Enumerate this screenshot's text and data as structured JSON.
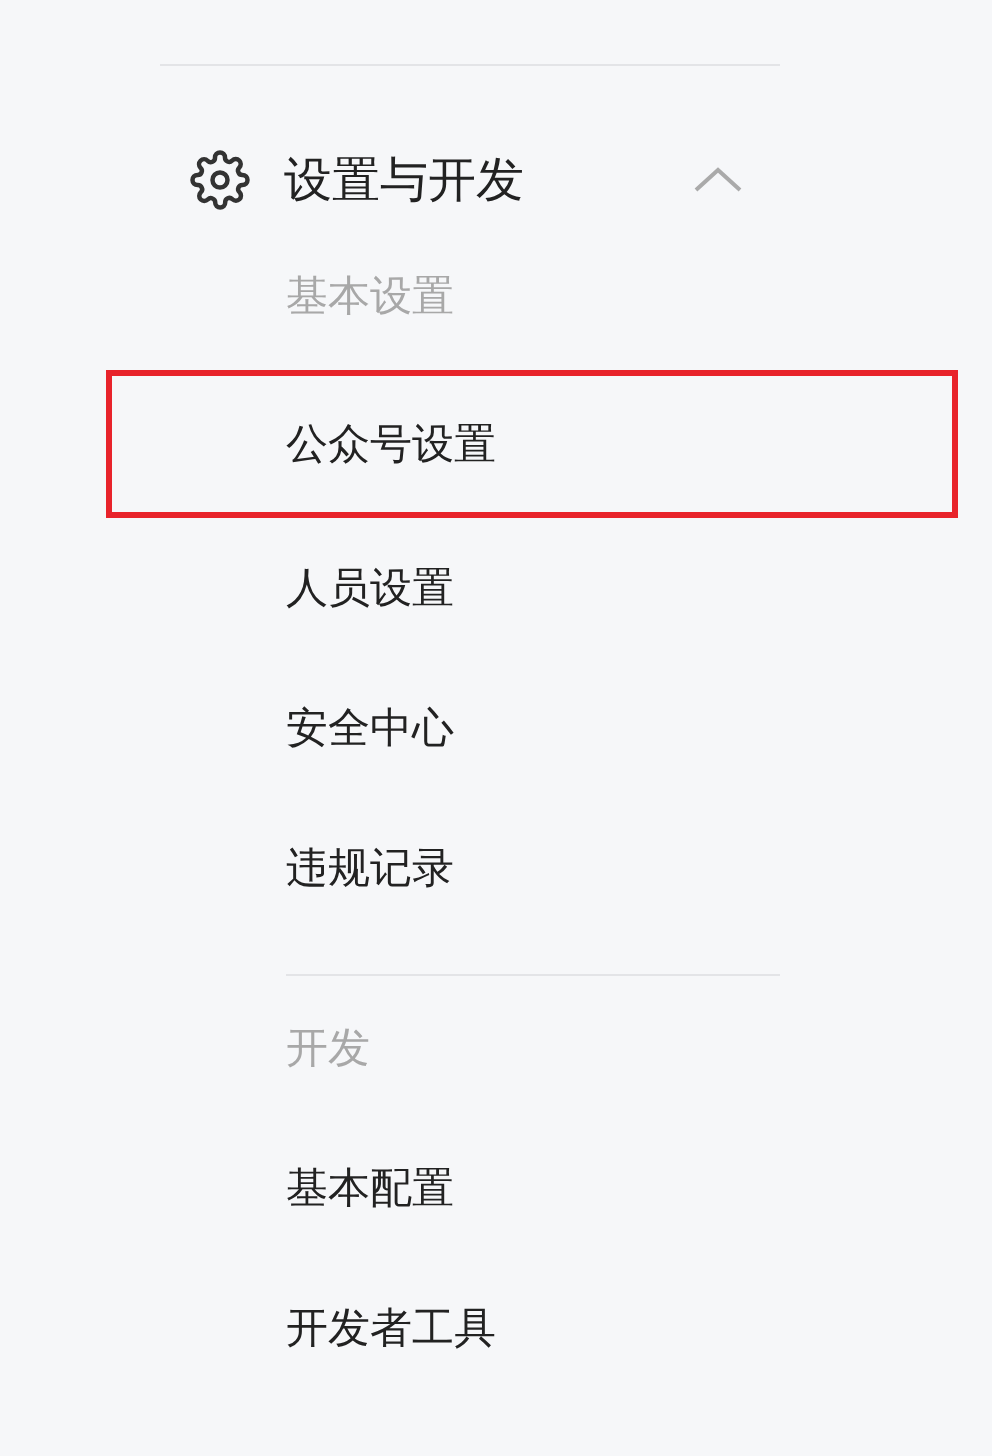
{
  "menu": {
    "title": "设置与开发",
    "expanded": true,
    "groups": [
      {
        "label": "基本设置",
        "items": [
          {
            "label": "公众号设置",
            "highlighted": true
          },
          {
            "label": "人员设置",
            "highlighted": false
          },
          {
            "label": "安全中心",
            "highlighted": false
          },
          {
            "label": "违规记录",
            "highlighted": false
          }
        ]
      },
      {
        "label": "开发",
        "items": [
          {
            "label": "基本配置",
            "highlighted": false
          },
          {
            "label": "开发者工具",
            "highlighted": false
          }
        ]
      }
    ]
  }
}
